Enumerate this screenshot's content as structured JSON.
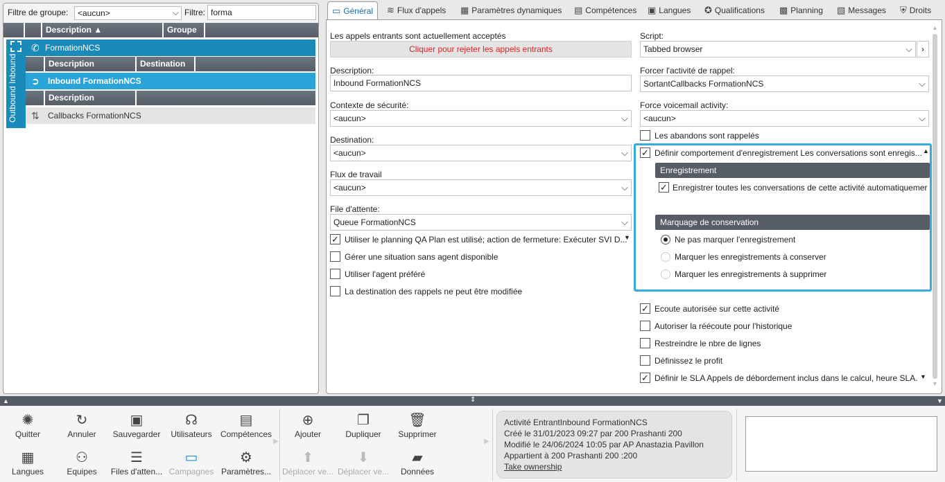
{
  "filter": {
    "group_label": "Filtre de groupe:",
    "group_value": "<aucun>",
    "filter_label": "Filtre:",
    "filter_value": "forma"
  },
  "grid": {
    "col_description": "Description ▲",
    "col_group": "Groupe",
    "group_side_label": "Outbound Inbound",
    "rows": [
      {
        "label": "FormationNCS"
      },
      {
        "label": "Inbound FormationNCS"
      },
      {
        "label": "Callbacks FormationNCS"
      }
    ],
    "sub_col_description": "Description",
    "sub_col_destination": "Destination",
    "sub2_col_description": "Description"
  },
  "tabs": [
    {
      "label": "Général",
      "icon": "monitor-icon"
    },
    {
      "label": "Flux d'appels",
      "icon": "flow-icon"
    },
    {
      "label": "Paramètres dynamiques",
      "icon": "grid-icon"
    },
    {
      "label": "Compétences",
      "icon": "skill-icon"
    },
    {
      "label": "Langues",
      "icon": "language-icon"
    },
    {
      "label": "Qualifications",
      "icon": "qualification-icon"
    },
    {
      "label": "Planning",
      "icon": "calendar-icon"
    },
    {
      "label": "Messages",
      "icon": "message-icon"
    },
    {
      "label": "Droits",
      "icon": "shield-icon"
    }
  ],
  "general": {
    "calls_status": "Les appels entrants sont actuellement acceptés",
    "reject_button": "Cliquer pour rejeter les appels entrants",
    "description_label": "Description:",
    "description_value": "Inbound FormationNCS",
    "security_label": "Contexte de sécurité:",
    "security_value": "<aucun>",
    "destination_label": "Destination:",
    "destination_value": "<aucun>",
    "workflow_label": "Flux de travail",
    "workflow_value": "<aucun>",
    "queue_label": "File d'attente:",
    "queue_value": "Queue FormationNCS",
    "use_planning": "Utiliser le planning  QA Plan est utilisé; action de fermeture: Exécuter SVI D...",
    "no_agent": "Gérer une situation sans agent disponible",
    "preferred_agent": "Utiliser l'agent préféré",
    "callback_dest": "La destination des rappels ne peut être modifiée",
    "script_label": "Script:",
    "script_value": "Tabbed browser",
    "force_callback_label": "Forcer l'activité de rappel:",
    "force_callback_value": "SortantCallbacks FormationNCS",
    "force_voicemail_label": "Force voicemail activity:",
    "force_voicemail_value": "<aucun>",
    "abandons": "Les abandons sont rappelés",
    "define_recording": "Définir comportement d'enregistrement  Les conversations sont enregis...",
    "recording_header": "Enregistrement",
    "record_all": "Enregistrer toutes les conversations de cette activité automatiquemer",
    "marking_header": "Marquage de conservation",
    "mark_none": "Ne pas marquer l'enregistrement",
    "mark_keep": "Marquer les enregistrements à conserver",
    "mark_delete": "Marquer les enregistrements à supprimer",
    "listen": "Ecoute autorisée sur cette activité",
    "relisten": "Autoriser la réécoute pour l'historique",
    "restrict_lines": "Restreindre le nbre de lignes",
    "define_profile": "Définissez le profit",
    "define_sla": "Définir le SLA  Appels de débordement inclus dans le calcul, heure SLA..."
  },
  "toolbar": {
    "quit": "Quitter",
    "cancel": "Annuler",
    "save": "Sauvegarder",
    "users": "Utilisateurs",
    "skills": "Compétences",
    "languages": "Langues",
    "teams": "Equipes",
    "queues": "Files d'atten...",
    "campaigns": "Campagnes",
    "params": "Paramètres...",
    "add": "Ajouter",
    "duplicate": "Dupliquer",
    "delete": "Supprimer",
    "move_up": "Déplacer ve...",
    "move_down": "Déplacer ve...",
    "data": "Données"
  },
  "info": {
    "line1": "Activité EntrantInbound FormationNCS",
    "line2": "Créé le 31/01/2023 09:27 par 200 Prashanti 200",
    "line3": "Modifié le 24/06/2024 10:05 par AP Anastazia Pavillon",
    "line4": "Appartient à 200 Prashanti 200 :200",
    "link": "Take ownership"
  },
  "colors": {
    "accent": "#1a8ab8",
    "row_selected": "#2aa3d8",
    "header_dark": "#565d67",
    "highlight": "#35aadc",
    "reject_text": "#e02020"
  }
}
